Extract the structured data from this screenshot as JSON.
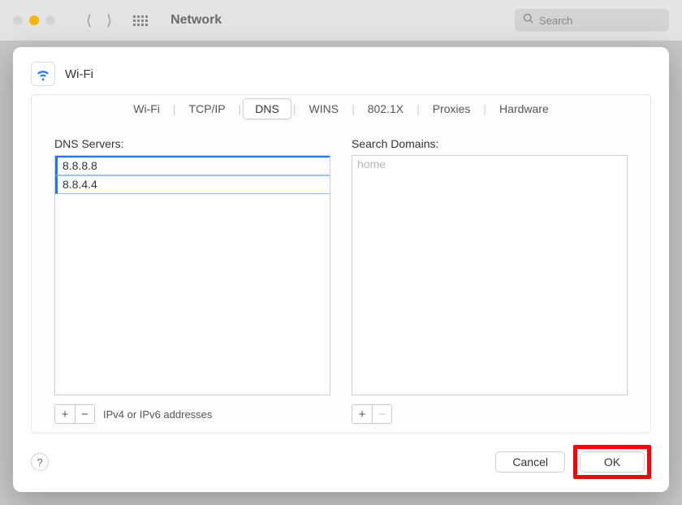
{
  "window": {
    "title": "Network",
    "search_placeholder": "Search"
  },
  "sheet": {
    "title": "Wi-Fi",
    "tabs": [
      "Wi-Fi",
      "TCP/IP",
      "DNS",
      "WINS",
      "802.1X",
      "Proxies",
      "Hardware"
    ],
    "active_tab_index": 2,
    "dns_servers": {
      "label": "DNS Servers:",
      "entries": [
        "8.8.8.8",
        "8.8.4.4"
      ],
      "hint": "IPv4 or IPv6 addresses"
    },
    "search_domains": {
      "label": "Search Domains:",
      "placeholder": "home"
    },
    "buttons": {
      "cancel": "Cancel",
      "ok": "OK",
      "help": "?"
    }
  }
}
